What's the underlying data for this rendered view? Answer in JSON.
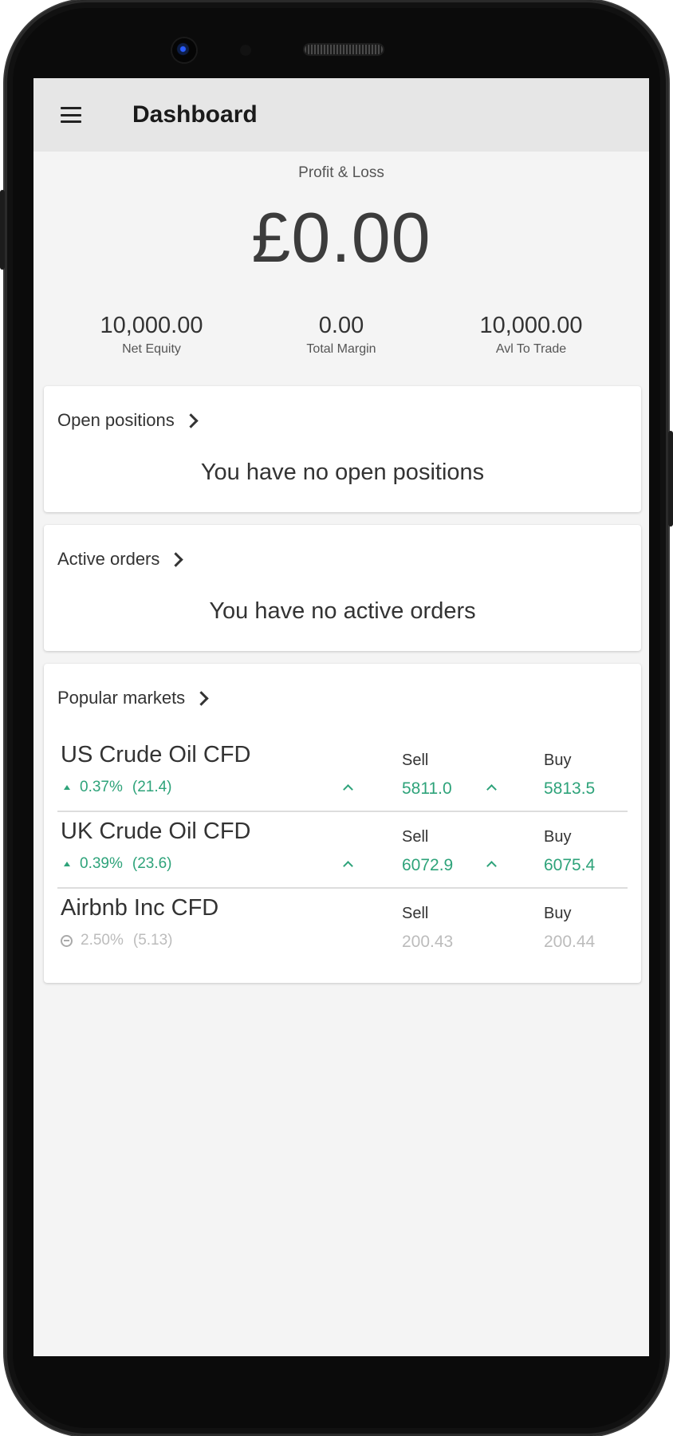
{
  "app_bar": {
    "title": "Dashboard",
    "menu_icon": "hamburger-menu-icon"
  },
  "pnl": {
    "label": "Profit & Loss",
    "value": "£0.00"
  },
  "stats": [
    {
      "value": "10,000.00",
      "label": "Net Equity"
    },
    {
      "value": "0.00",
      "label": "Total Margin"
    },
    {
      "value": "10,000.00",
      "label": "Avl To Trade"
    }
  ],
  "open_positions": {
    "title": "Open positions",
    "empty_text": "You have no open positions"
  },
  "active_orders": {
    "title": "Active orders",
    "empty_text": "You have no active orders"
  },
  "popular_markets": {
    "title": "Popular markets",
    "items": [
      {
        "name": "US Crude Oil CFD",
        "change_pct": "0.37%",
        "change_abs": "(21.4)",
        "sell_label": "Sell",
        "sell": "5811.0",
        "buy_label": "Buy",
        "buy": "5813.5",
        "trend": "up"
      },
      {
        "name": "UK Crude Oil CFD",
        "change_pct": "0.39%",
        "change_abs": "(23.6)",
        "sell_label": "Sell",
        "sell": "6072.9",
        "buy_label": "Buy",
        "buy": "6075.4",
        "trend": "up"
      },
      {
        "name": "Airbnb Inc CFD",
        "change_pct": "2.50%",
        "change_abs": "(5.13)",
        "sell_label": "Sell",
        "sell": "200.43",
        "buy_label": "Buy",
        "buy": "200.44",
        "trend": "closed"
      }
    ]
  },
  "colors": {
    "positive": "#2ea37a",
    "muted": "#bcbcbc",
    "app_bar_bg": "#e6e6e6",
    "screen_bg": "#f4f4f4"
  }
}
